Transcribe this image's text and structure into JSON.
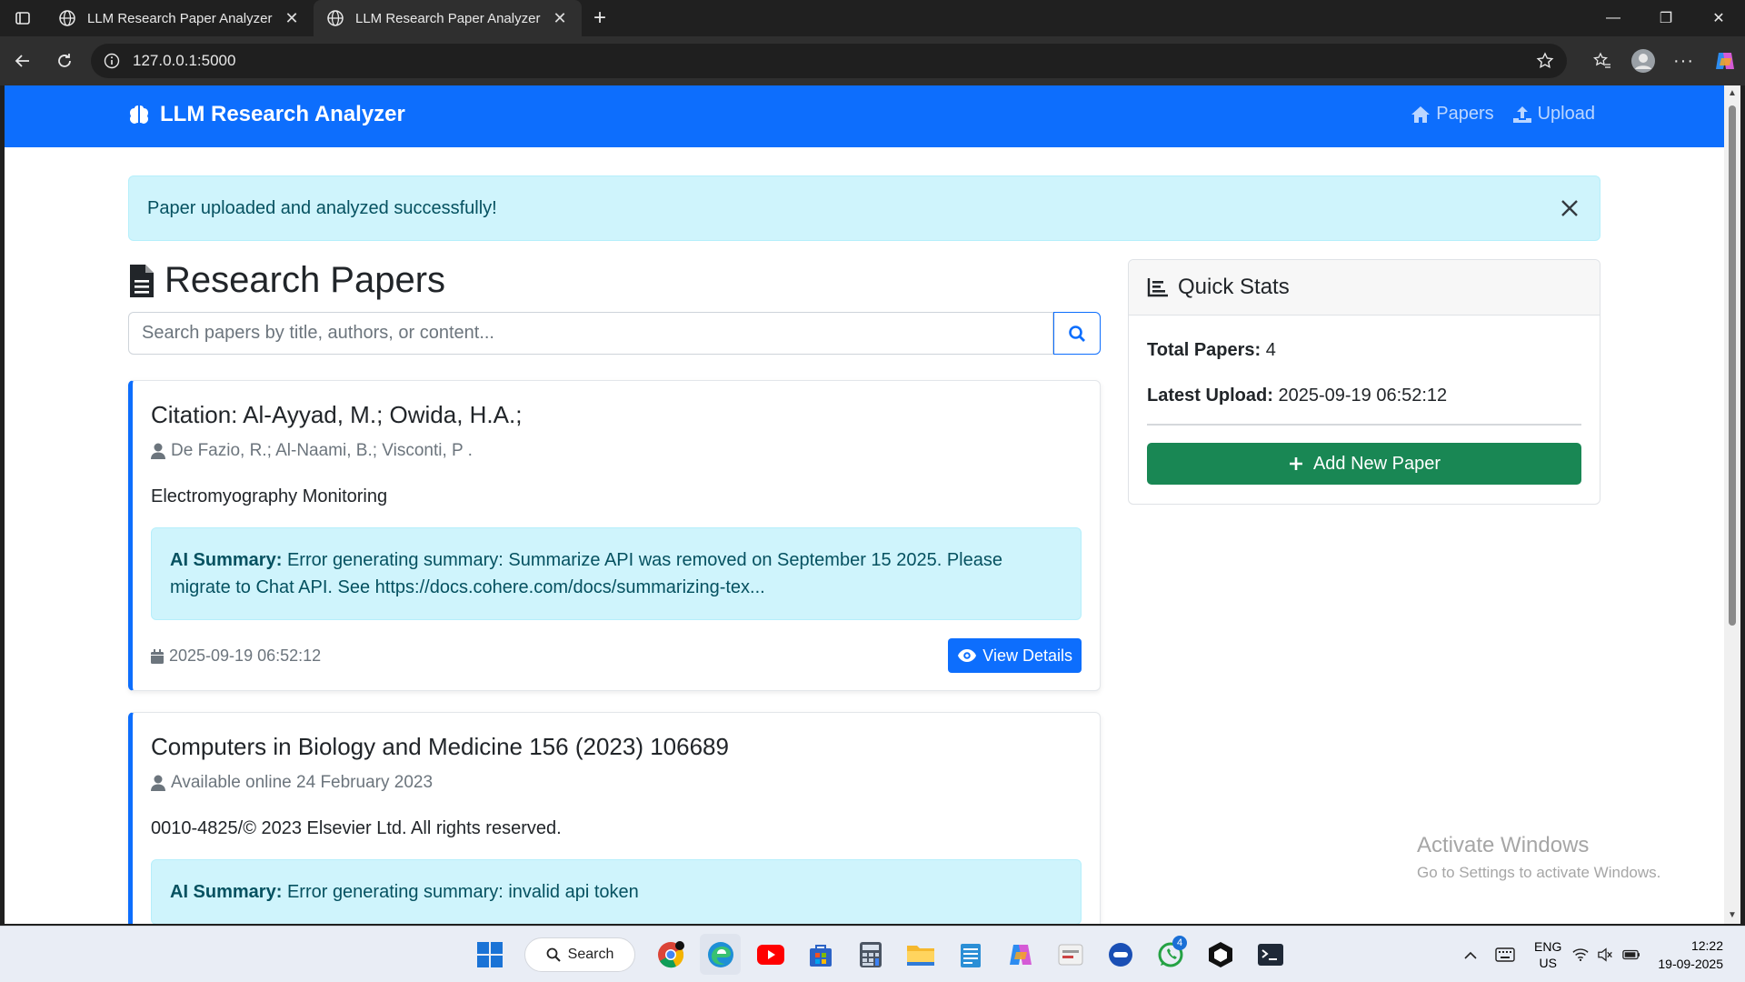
{
  "browser": {
    "tabs": [
      {
        "title": "LLM Research Paper Analyzer",
        "active": false
      },
      {
        "title": "LLM Research Paper Analyzer",
        "active": true
      }
    ],
    "url": "127.0.0.1:5000"
  },
  "navbar": {
    "brand": "LLM Research Analyzer",
    "links": [
      {
        "label": "Papers",
        "icon": "home-icon"
      },
      {
        "label": "Upload",
        "icon": "upload-icon"
      }
    ],
    "color": "#0d6efd"
  },
  "alert": {
    "message": "Paper uploaded and analyzed successfully!"
  },
  "main": {
    "title": "Research Papers",
    "search": {
      "placeholder": "Search papers by title, authors, or content...",
      "value": ""
    },
    "papers": [
      {
        "title": "Citation: Al-Ayyad, M.; Owida, H.A.;",
        "authors": "De Fazio, R.; Al-Naami, B.; Visconti, P .",
        "description": "Electromyography Monitoring",
        "summary_label": "AI Summary:",
        "summary": "Error generating summary: Summarize API was removed on September 15 2025. Please migrate to Chat API. See https://docs.cohere.com/docs/summarizing-tex...",
        "date": "2025-09-19 06:52:12",
        "action": "View Details"
      },
      {
        "title": "Computers in Biology and Medicine 156 (2023) 106689",
        "authors": "Available online 24 February 2023",
        "description": "0010-4825/© 2023 Elsevier Ltd. All rights reserved.",
        "summary_label": "AI Summary:",
        "summary": "Error generating summary: invalid api token"
      }
    ]
  },
  "stats": {
    "title": "Quick Stats",
    "total_label": "Total Papers:",
    "total_value": "4",
    "latest_label": "Latest Upload:",
    "latest_value": "2025-09-19 06:52:12",
    "add_button": "Add New Paper"
  },
  "watermark": {
    "line1": "Activate Windows",
    "line2": "Go to Settings to activate Windows."
  },
  "taskbar": {
    "search_label": "Search",
    "whatsapp_badge": "4",
    "lang_top": "ENG",
    "lang_bottom": "US",
    "time": "12:22",
    "date": "19-09-2025"
  }
}
